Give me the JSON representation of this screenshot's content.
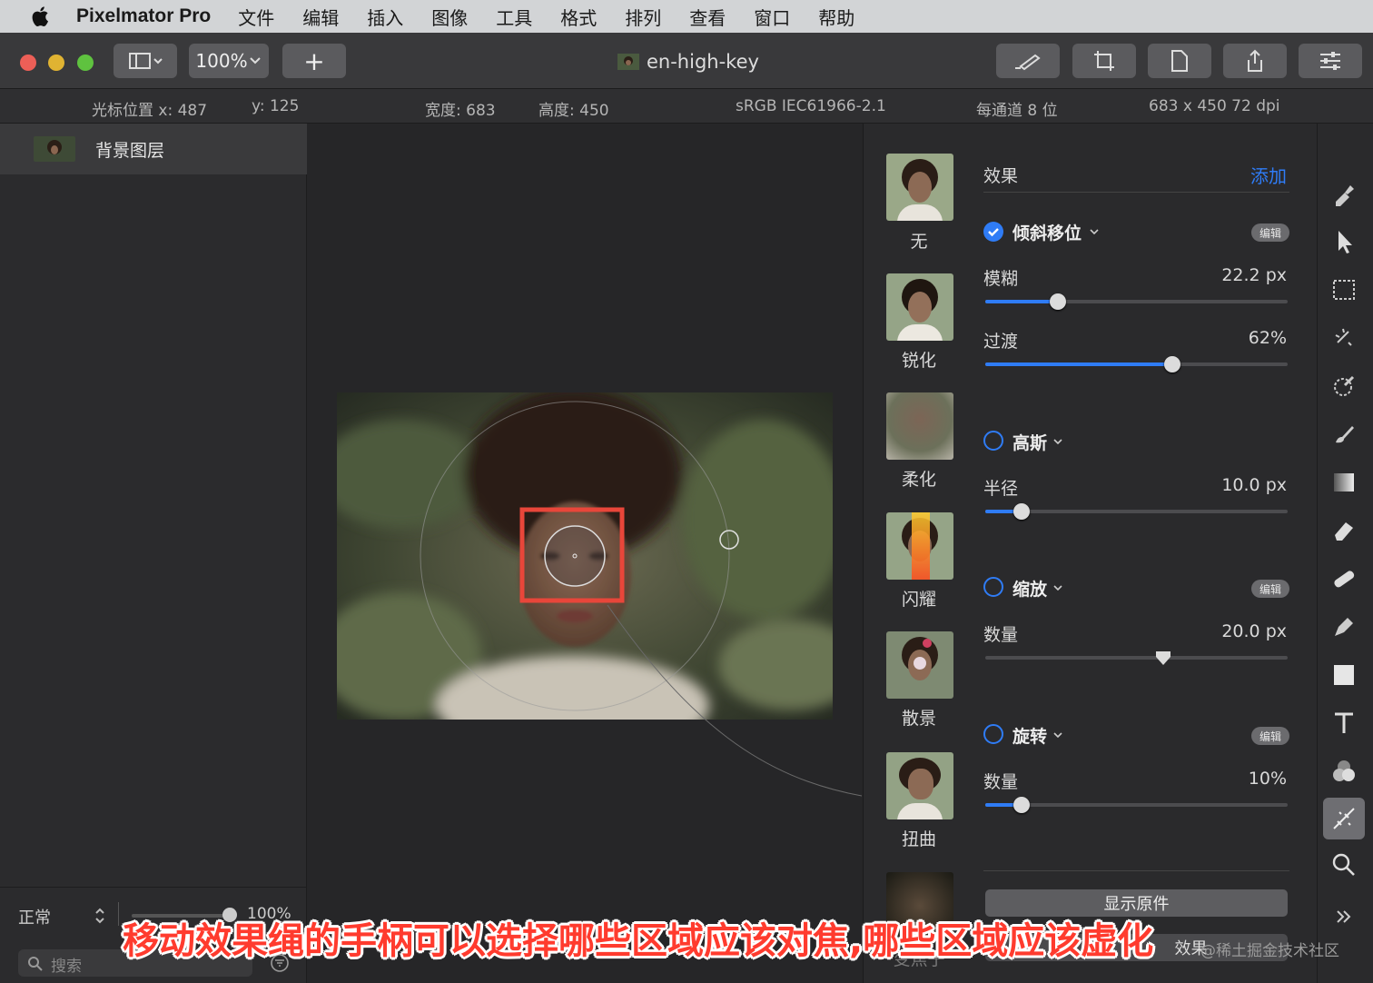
{
  "menubar": {
    "app_name": "Pixelmator Pro",
    "items": [
      "文件",
      "编辑",
      "插入",
      "图像",
      "工具",
      "格式",
      "排列",
      "查看",
      "窗口",
      "帮助"
    ]
  },
  "toolbar": {
    "zoom": "100%",
    "add_symbol": "+",
    "document_title": "en-high-key"
  },
  "infobar": {
    "cursor_x": "光标位置 x:  487",
    "cursor_y": "y:  125",
    "width": "宽度:  683",
    "height": "高度:  450",
    "color_profile": "sRGB IEC61966-2.1",
    "bit_depth": "每通道 8 位",
    "dimensions": "683 x 450 72 dpi"
  },
  "layers": {
    "layer_name": "背景图层",
    "blend_mode": "正常",
    "opacity": "100%",
    "search_placeholder": "搜索"
  },
  "effects_browser": {
    "presets": [
      "无",
      "锐化",
      "柔化",
      "闪耀",
      "散景",
      "扭曲",
      "变焦子"
    ]
  },
  "settings": {
    "header": "效果",
    "add_label": "添加",
    "effects": [
      {
        "name": "倾斜移位",
        "enabled": true,
        "edit": "编辑",
        "params": [
          {
            "label": "模糊",
            "value": "22.2 px",
            "level": 0.24
          },
          {
            "label": "过渡",
            "value": "62%",
            "level": 0.62
          }
        ]
      },
      {
        "name": "高斯",
        "enabled": false,
        "params": [
          {
            "label": "半径",
            "value": "10.0 px",
            "level": 0.12
          }
        ]
      },
      {
        "name": "缩放",
        "enabled": false,
        "edit": "编辑",
        "params": [
          {
            "label": "数量",
            "value": "20.0 px",
            "level": 0.59
          }
        ]
      },
      {
        "name": "旋转",
        "enabled": false,
        "edit": "编辑",
        "params": [
          {
            "label": "数量",
            "value": "10%",
            "level": 0.12
          }
        ]
      }
    ],
    "show_original": "显示原件",
    "bottom_partial": "效果"
  },
  "tools": [
    "style-tool",
    "arrange-tool",
    "selection-tool",
    "smart-selection-tool",
    "color-adjust-tool",
    "paint-tool",
    "gradient-tool",
    "erase-tool",
    "repair-tool",
    "pen-tool",
    "shape-tool",
    "type-tool",
    "color-tool",
    "effects-tool",
    "zoom-tool"
  ],
  "overlay": {
    "subtitle": "移动效果绳的手柄可以选择哪些区域应该对焦,哪些区域应该虚化",
    "watermark": "@稀土掘金技术社区"
  },
  "colors": {
    "accent": "#2f7cf6",
    "highlight_box": "#e8463a"
  }
}
